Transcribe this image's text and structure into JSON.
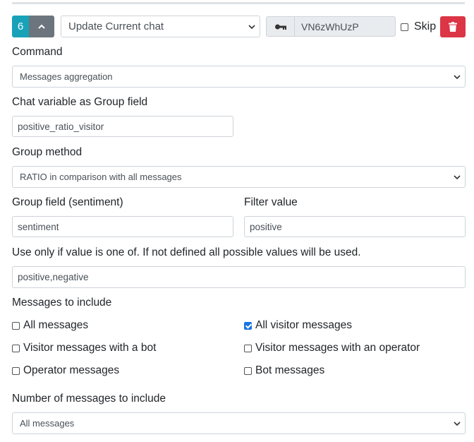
{
  "header": {
    "step_number": "6",
    "action_select": "Update Current chat",
    "key_value": "VN6zWhUzP",
    "skip_label": "Skip"
  },
  "command": {
    "label": "Command",
    "value": "Messages aggregation"
  },
  "chat_variable": {
    "label": "Chat variable as Group field",
    "value": "positive_ratio_visitor"
  },
  "group_method": {
    "label": "Group method",
    "value": "RATIO in comparison with all messages"
  },
  "group_field": {
    "label": "Group field (sentiment)",
    "value": "sentiment"
  },
  "filter_value": {
    "label": "Filter value",
    "value": "positive"
  },
  "values_restriction": {
    "label": "Use only if value is one of. If not defined all possible values will be used.",
    "value": "positive,negative"
  },
  "messages_to_include": {
    "label": "Messages to include",
    "options": [
      {
        "label": "All messages",
        "checked": false
      },
      {
        "label": "All visitor messages",
        "checked": true
      },
      {
        "label": "Visitor messages with a bot",
        "checked": false
      },
      {
        "label": "Visitor messages with an operator",
        "checked": false
      },
      {
        "label": "Operator messages",
        "checked": false
      },
      {
        "label": "Bot messages",
        "checked": false
      }
    ]
  },
  "number_of_messages": {
    "label": "Number of messages to include",
    "value": "All messages"
  },
  "colors": {
    "step_badge": "#17a2b8",
    "collapse_button": "#6c757d",
    "delete_button": "#dc3545",
    "checkbox_checked": "#1a73e8"
  },
  "icons": {
    "collapse": "chevron-up-icon",
    "key": "key-icon",
    "delete": "trash-icon",
    "dropdown": "chevron-down-icon"
  }
}
